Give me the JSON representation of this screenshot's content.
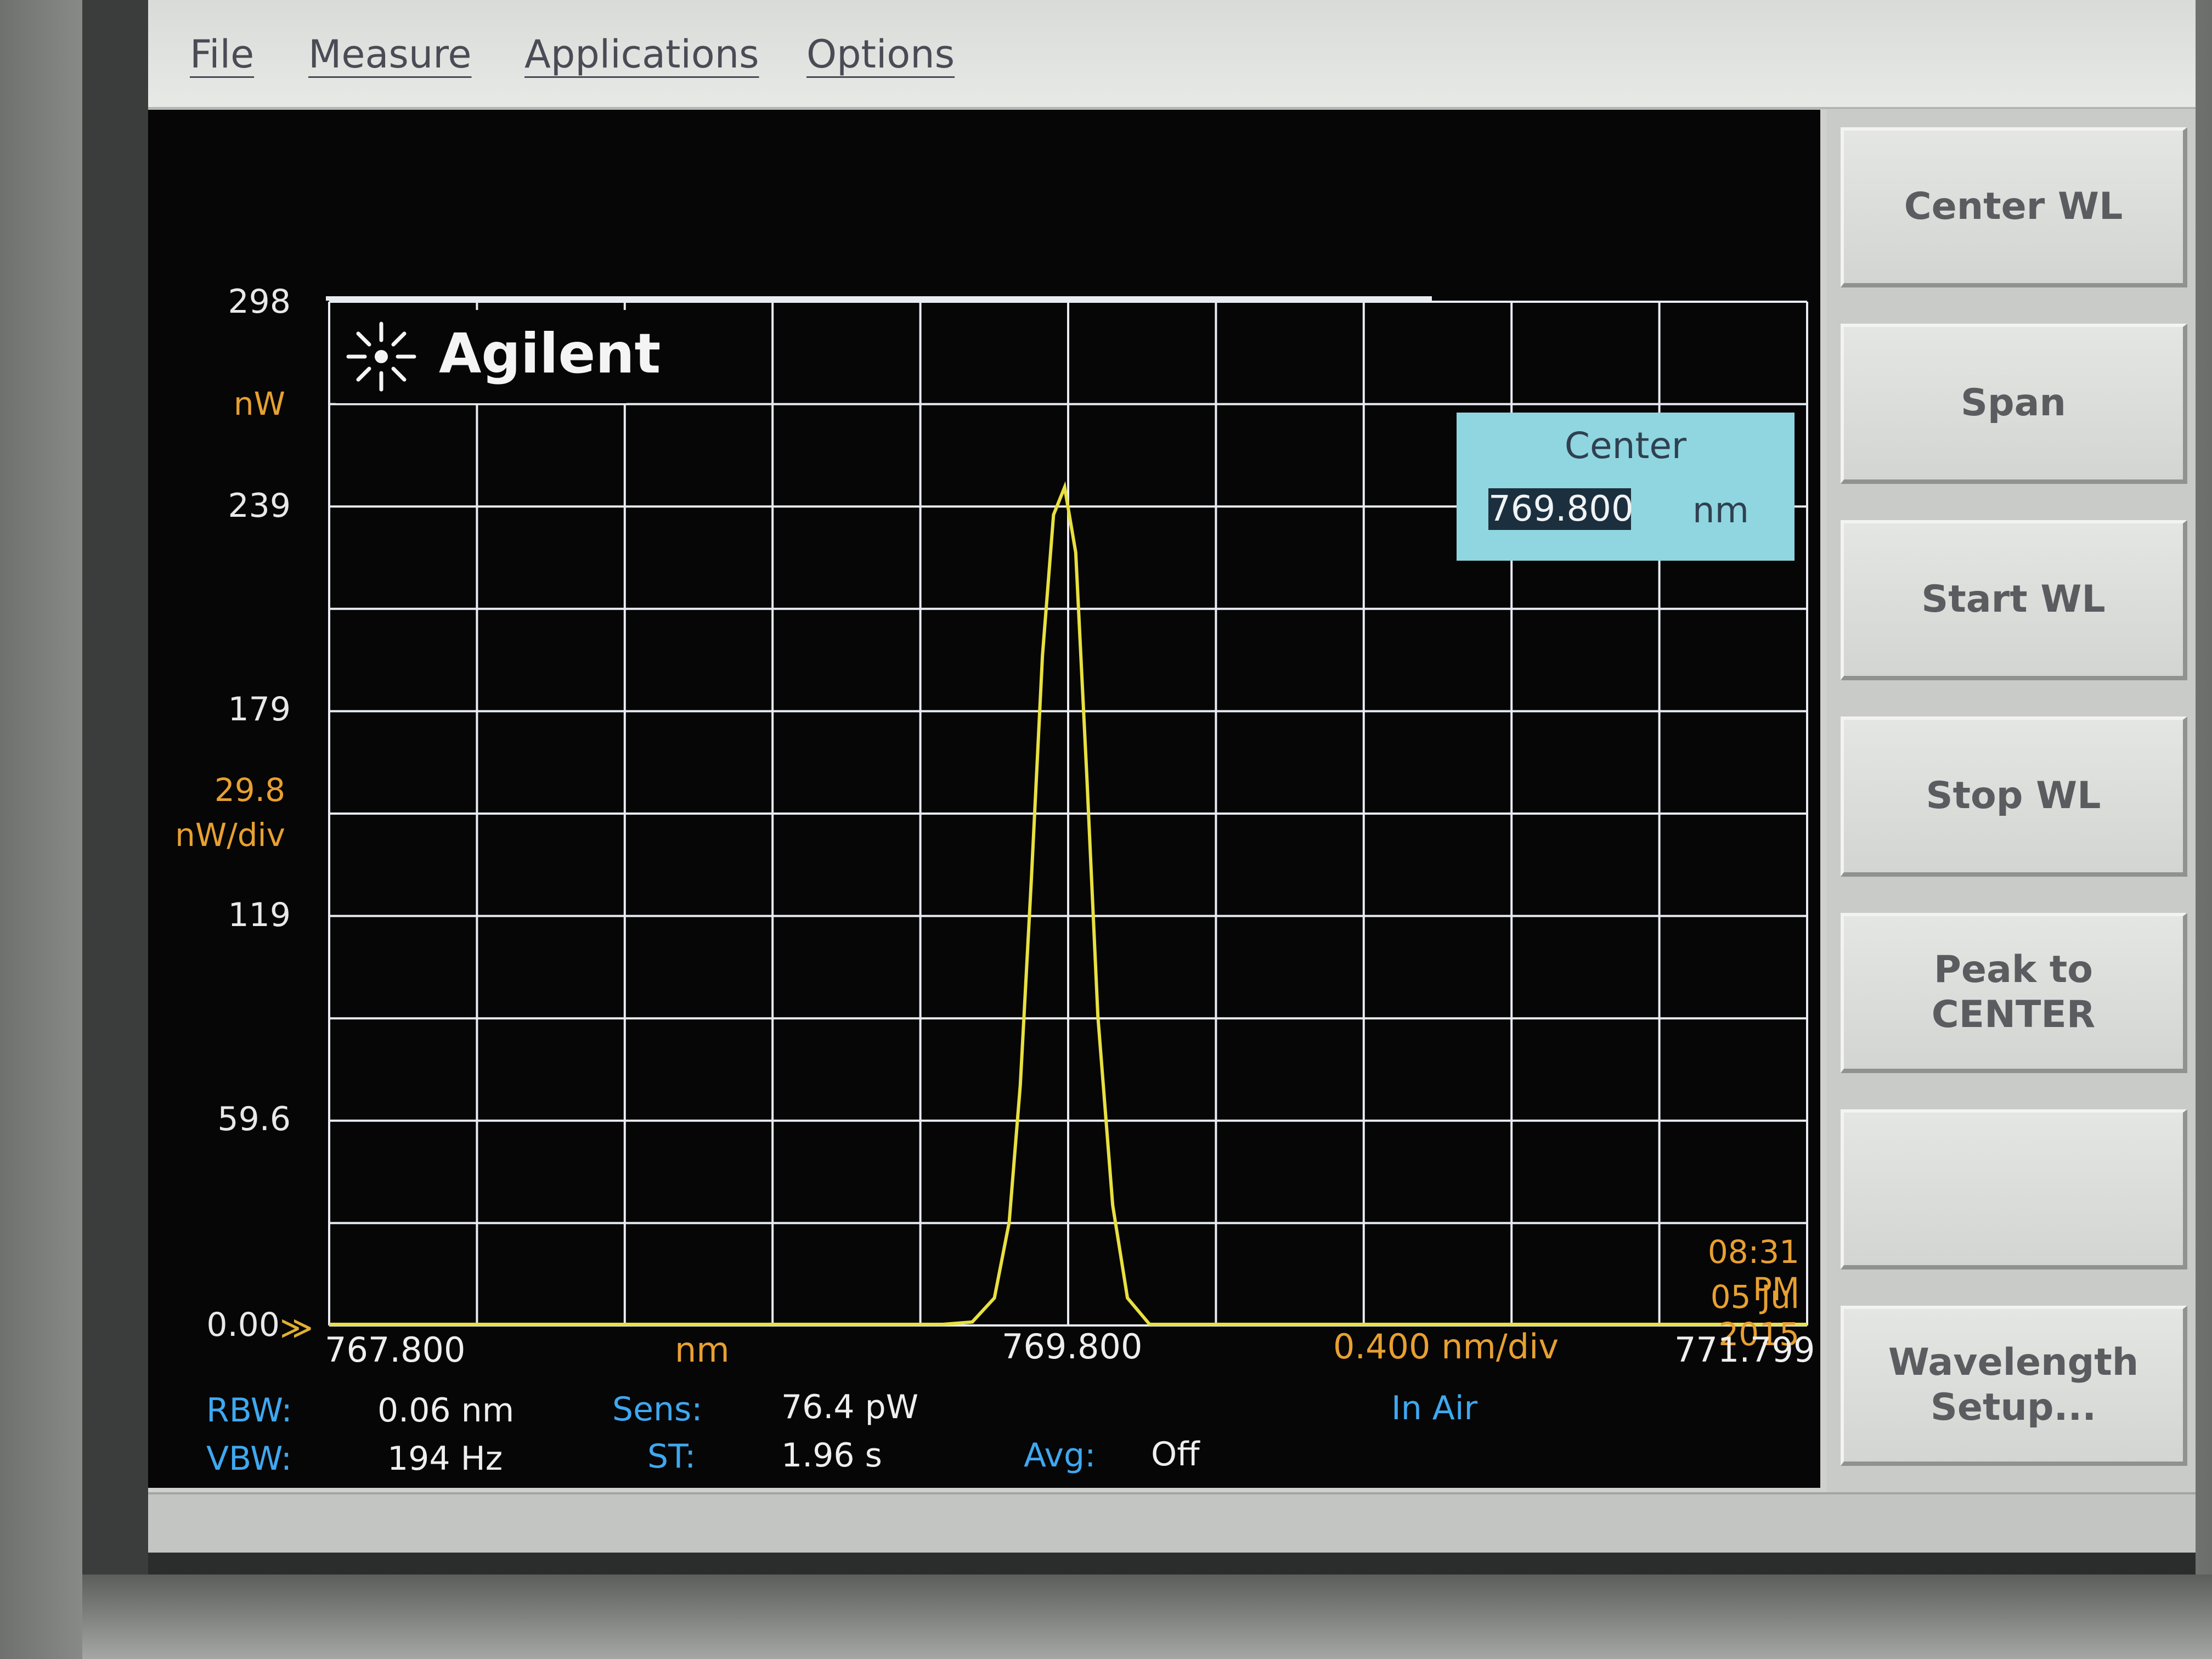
{
  "menu": {
    "file": "File",
    "measure": "Measure",
    "applications": "Applications",
    "options": "Options"
  },
  "logo": {
    "text": "Agilent"
  },
  "y_axis": {
    "ticks": [
      "298",
      "239",
      "179",
      "119",
      "59.6",
      "0.00"
    ],
    "unit": "nW",
    "scale_value": "29.8",
    "scale_unit": "nW/div"
  },
  "center_box": {
    "label": "Center",
    "value": "769.800",
    "unit": "nm"
  },
  "x_axis": {
    "start": "767.800",
    "unit": "nm",
    "center": "769.800",
    "scale": "0.400 nm/div",
    "stop": "771.799"
  },
  "timestamp": {
    "time": "08:31 PM",
    "date": "05 Jul 2015"
  },
  "info": {
    "rbw_label": "RBW:",
    "rbw_value": "0.06 nm",
    "vbw_label": "VBW:",
    "vbw_value": "194 Hz",
    "sens_label": "Sens:",
    "sens_value": "76.4 pW",
    "st_label": "ST:",
    "st_value": "1.96 s",
    "avg_label": "Avg:",
    "avg_value": "Off",
    "medium": "In Air"
  },
  "softkeys": {
    "center_wl": "Center WL",
    "span": "Span",
    "start_wl": "Start WL",
    "stop_wl": "Stop WL",
    "peak_to_center": "Peak to\nCENTER",
    "blank": "",
    "wavelength_setup": "Wavelength\nSetup..."
  },
  "colors": {
    "trace": "#e8e040",
    "grid": "#e8ecf2",
    "accent_orange": "#e8a030",
    "accent_blue": "#3fa8f0",
    "highlight_box": "#8fd6e0"
  },
  "chart_data": {
    "type": "line",
    "xlabel": "nm",
    "ylabel": "nW",
    "xlim": [
      767.8,
      771.799
    ],
    "ylim": [
      0,
      298
    ],
    "grid": true,
    "series": [
      {
        "x": [
          767.8,
          769.46,
          769.54,
          769.6,
          769.64,
          769.67,
          769.7,
          769.73,
          769.76,
          769.79,
          769.82,
          769.85,
          769.88,
          769.92,
          769.96,
          770.02,
          771.799
        ],
        "y": [
          0,
          0,
          1,
          8,
          30,
          70,
          130,
          195,
          236,
          244,
          225,
          160,
          90,
          35,
          8,
          0,
          0
        ]
      }
    ]
  }
}
